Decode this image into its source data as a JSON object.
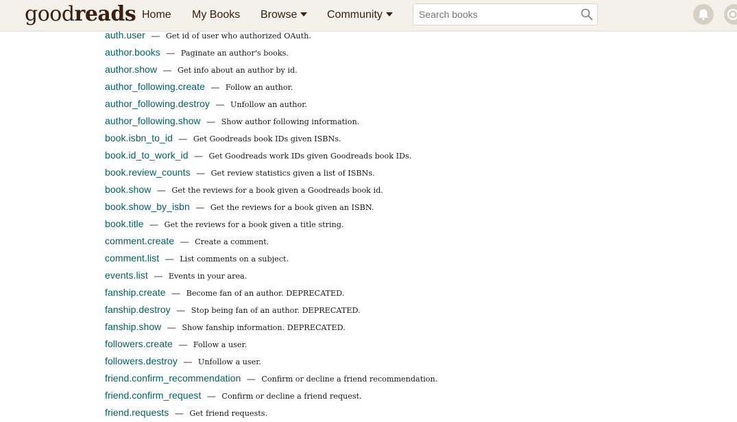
{
  "header": {
    "logo_light": "good",
    "logo_bold": "reads",
    "nav": {
      "home": "Home",
      "my_books": "My Books",
      "browse": "Browse",
      "community": "Community"
    },
    "search": {
      "placeholder": "Search books",
      "value": ""
    }
  },
  "separator": "—",
  "methods": [
    {
      "name": "auth.user",
      "desc": "Get id of user who authorized OAuth."
    },
    {
      "name": "author.books",
      "desc": "Paginate an author's books."
    },
    {
      "name": "author.show",
      "desc": "Get info about an author by id."
    },
    {
      "name": "author_following.create",
      "desc": "Follow an author."
    },
    {
      "name": "author_following.destroy",
      "desc": "Unfollow an author."
    },
    {
      "name": "author_following.show",
      "desc": "Show author following information."
    },
    {
      "name": "book.isbn_to_id",
      "desc": "Get Goodreads book IDs given ISBNs."
    },
    {
      "name": "book.id_to_work_id",
      "desc": "Get Goodreads work IDs given Goodreads book IDs."
    },
    {
      "name": "book.review_counts",
      "desc": "Get review statistics given a list of ISBNs."
    },
    {
      "name": "book.show",
      "desc": "Get the reviews for a book given a Goodreads book id."
    },
    {
      "name": "book.show_by_isbn",
      "desc": "Get the reviews for a book given an ISBN."
    },
    {
      "name": "book.title",
      "desc": "Get the reviews for a book given a title string."
    },
    {
      "name": "comment.create",
      "desc": "Create a comment."
    },
    {
      "name": "comment.list",
      "desc": "List comments on a subject."
    },
    {
      "name": "events.list",
      "desc": "Events in your area."
    },
    {
      "name": "fanship.create",
      "desc": "Become fan of an author. DEPRECATED."
    },
    {
      "name": "fanship.destroy",
      "desc": "Stop being fan of an author. DEPRECATED."
    },
    {
      "name": "fanship.show",
      "desc": "Show fanship information. DEPRECATED."
    },
    {
      "name": "followers.create",
      "desc": "Follow a user."
    },
    {
      "name": "followers.destroy",
      "desc": "Unfollow a user."
    },
    {
      "name": "friend.confirm_recommendation",
      "desc": "Confirm or decline a friend recommendation."
    },
    {
      "name": "friend.confirm_request",
      "desc": "Confirm or decline a friend request."
    },
    {
      "name": "friend.requests",
      "desc": "Get friend requests."
    }
  ]
}
